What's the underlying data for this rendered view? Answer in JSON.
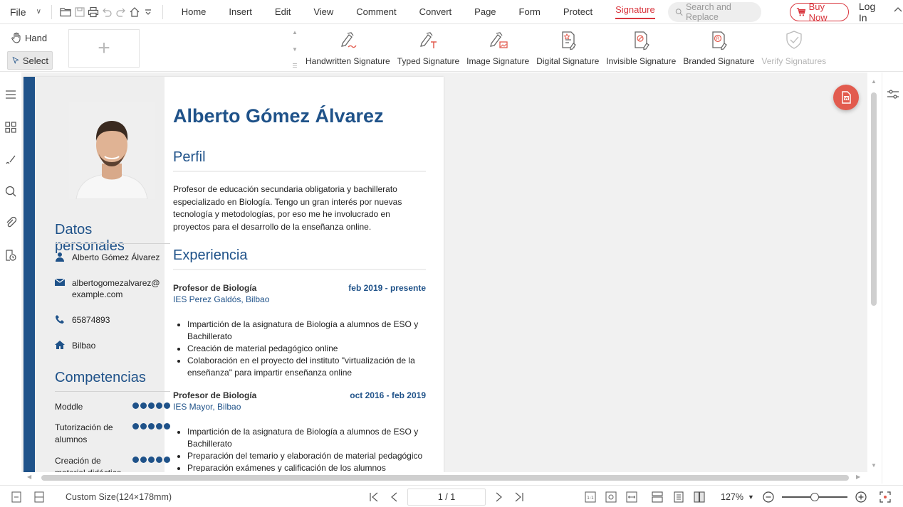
{
  "menubar": {
    "file_label": "File",
    "items": [
      "Home",
      "Insert",
      "Edit",
      "View",
      "Comment",
      "Convert",
      "Page",
      "Form",
      "Protect",
      "Signature"
    ],
    "active_item": "Signature",
    "search_placeholder": "Search and Replace",
    "buy_now": "Buy Now",
    "login": "Log In"
  },
  "ribbon": {
    "hand_label": "Hand",
    "select_label": "Select",
    "buttons": [
      {
        "label": "Handwritten Signature",
        "icon": "handwritten-signature-icon",
        "enabled": true
      },
      {
        "label": "Typed Signature",
        "icon": "typed-signature-icon",
        "enabled": true
      },
      {
        "label": "Image Signature",
        "icon": "image-signature-icon",
        "enabled": true
      },
      {
        "label": "Digital Signature",
        "icon": "digital-signature-icon",
        "enabled": true
      },
      {
        "label": "Invisible Signature",
        "icon": "invisible-signature-icon",
        "enabled": true
      },
      {
        "label": "Branded Signature",
        "icon": "branded-signature-icon",
        "enabled": true
      },
      {
        "label": "Verify Signatures",
        "icon": "verify-signatures-icon",
        "enabled": false
      }
    ]
  },
  "document": {
    "name": "Alberto Gómez Álvarez",
    "left": {
      "personal_heading": "Datos personales",
      "personal_items": [
        {
          "icon": "person-icon",
          "text": "Alberto Gómez Álvarez"
        },
        {
          "icon": "email-icon",
          "text": "albertogomezalvarez@\nexample.com"
        },
        {
          "icon": "phone-icon",
          "text": "65874893"
        },
        {
          "icon": "home-icon",
          "text": "Bilbao"
        }
      ],
      "skills_heading": "Competencias",
      "skills": [
        {
          "name": "Moddle",
          "level": 5
        },
        {
          "name": "Tutorización de alumnos",
          "level": 5
        },
        {
          "name": "Creación de material didáctico",
          "level": 5
        }
      ]
    },
    "profile_heading": "Perfil",
    "profile_text": "Profesor de educación secundaria obligatoria y bachillerato especializado en Biología. Tengo un gran interés por nuevas tecnología y metodologías, por eso me he involucrado en proyectos para el desarrollo de la enseñanza online.",
    "experience_heading": "Experiencia",
    "jobs": [
      {
        "title": "Profesor de Biología",
        "dates": "feb 2019 - presente",
        "place": "IES Perez Galdós, Bilbao",
        "bullets": [
          "Impartición de la asignatura de Biología a alumnos de ESO y Bachillerato",
          "Creación de material pedagógico online",
          "Colaboración en el proyecto del instituto \"virtualización de la enseñanza\" para impartir enseñanza online"
        ]
      },
      {
        "title": "Profesor de Biología",
        "dates": "oct 2016 - feb 2019",
        "place": "IES Mayor, Bilbao",
        "bullets": [
          "Impartición de la asignatura de Biología a alumnos de ESO y Bachillerato",
          "Preparación del temario y elaboración de material pedagógico",
          "Preparación exámenes y calificación de los alumnos"
        ]
      }
    ]
  },
  "statusbar": {
    "page_size": "Custom Size(124×178mm)",
    "page_indicator": "1 / 1",
    "zoom": "127%",
    "zoom_fraction": 0.5
  },
  "colors": {
    "accent": "#d9363e",
    "resume_blue": "#1f5289"
  }
}
